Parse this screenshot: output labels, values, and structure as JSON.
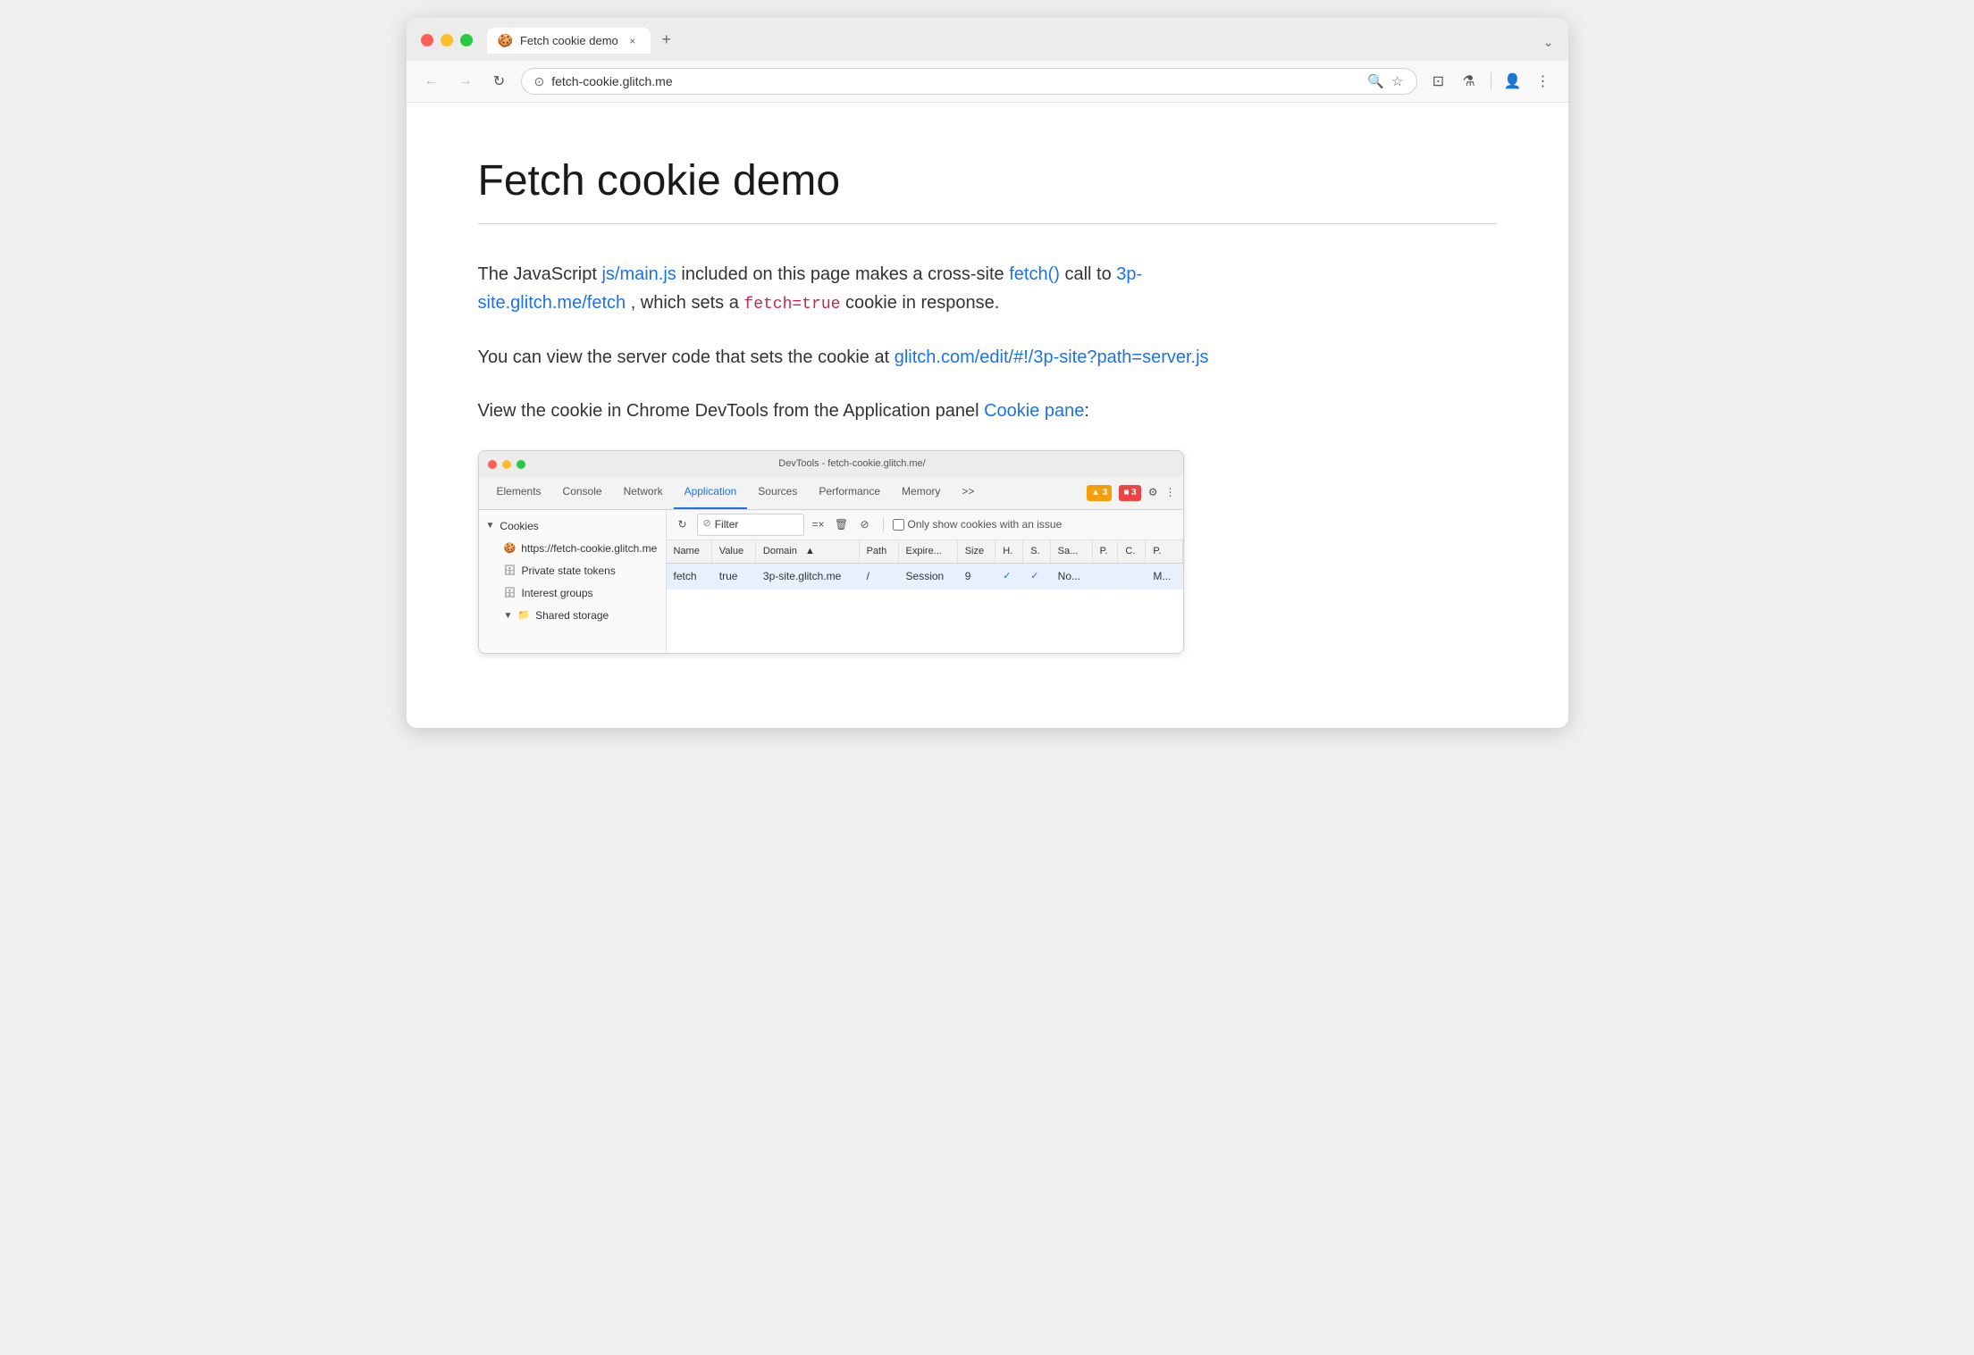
{
  "browser": {
    "tab": {
      "favicon": "🍪",
      "title": "Fetch cookie demo",
      "close_label": "×"
    },
    "new_tab_label": "+",
    "chevron_label": "⌄",
    "nav": {
      "back_label": "←",
      "forward_label": "→",
      "reload_label": "↻",
      "url": "fetch-cookie.glitch.me",
      "security_icon": "⊙",
      "search_icon": "🔍",
      "star_icon": "☆",
      "extensions_icon": "⊡",
      "experiment_icon": "⚗",
      "account_icon": "👤",
      "menu_icon": "⋮"
    }
  },
  "page": {
    "title": "Fetch cookie demo",
    "body": {
      "paragraph1_prefix": "The JavaScript ",
      "paragraph1_link1": "js/main.js",
      "paragraph1_link1_href": "https://fetch-cookie.glitch.me/js/main.js",
      "paragraph1_middle": " included on this page makes a cross-site ",
      "paragraph1_link2": "fetch()",
      "paragraph1_link2_href": "#",
      "paragraph1_after": " call to ",
      "paragraph1_link3": "3p-site.glitch.me/fetch",
      "paragraph1_link3_href": "https://3p-site.glitch.me/fetch",
      "paragraph1_end": ", which sets a ",
      "paragraph1_code": "fetch=true",
      "paragraph1_tail": " cookie in response.",
      "paragraph2_prefix": "You can view the server code that sets the cookie at ",
      "paragraph2_link": "glitch.com/edit/#!/3p-site?path=server.js",
      "paragraph2_link_href": "https://glitch.com/edit/#!/3p-site?path=server.js",
      "paragraph3_prefix": "View the cookie in Chrome DevTools from the Application panel ",
      "paragraph3_link": "Cookie pane",
      "paragraph3_link_href": "#",
      "paragraph3_suffix": ":"
    }
  },
  "devtools": {
    "titlebar_text": "DevTools - fetch-cookie.glitch.me/",
    "tabs": [
      "Elements",
      "Console",
      "Network",
      "Application",
      "Sources",
      "Performance",
      "Memory",
      ">>"
    ],
    "active_tab": "Application",
    "toolbar": {
      "warning_count": "▲ 3",
      "error_count": "■ 3",
      "settings_icon": "⚙",
      "more_icon": "⋮"
    },
    "cookies_toolbar": {
      "refresh_icon": "↻",
      "filter_placeholder": "Filter",
      "clear_icon": "=×",
      "delete_icon": "🗑",
      "filter_icon": "⊘",
      "issue_checkbox_label": "Only show cookies with an issue"
    },
    "sidebar": {
      "items": [
        {
          "label": "▼ Cookies",
          "type": "parent",
          "icon": ""
        },
        {
          "label": "https://fetch-cookie.glitch.me",
          "type": "child",
          "icon": "🍪"
        },
        {
          "label": "Private state tokens",
          "type": "child2",
          "icon": "🗄"
        },
        {
          "label": "Interest groups",
          "type": "child2",
          "icon": "🗄"
        },
        {
          "label": "▼ Shared storage",
          "type": "child2",
          "icon": "📁"
        }
      ]
    },
    "table": {
      "headers": [
        "Name",
        "Value",
        "Domain",
        "▲",
        "Path",
        "Expire...",
        "Size",
        "H.",
        "S.",
        "Sa...",
        "P.",
        "C.",
        "P."
      ],
      "rows": [
        {
          "name": "fetch",
          "value": "true",
          "domain": "3p-site.glitch.me",
          "sort": "",
          "path": "/",
          "expires": "Session",
          "size": "9",
          "h": "✓",
          "s": "✓.",
          "sa": "No...",
          "p": "",
          "c": "",
          "p2": "M..."
        }
      ]
    }
  }
}
